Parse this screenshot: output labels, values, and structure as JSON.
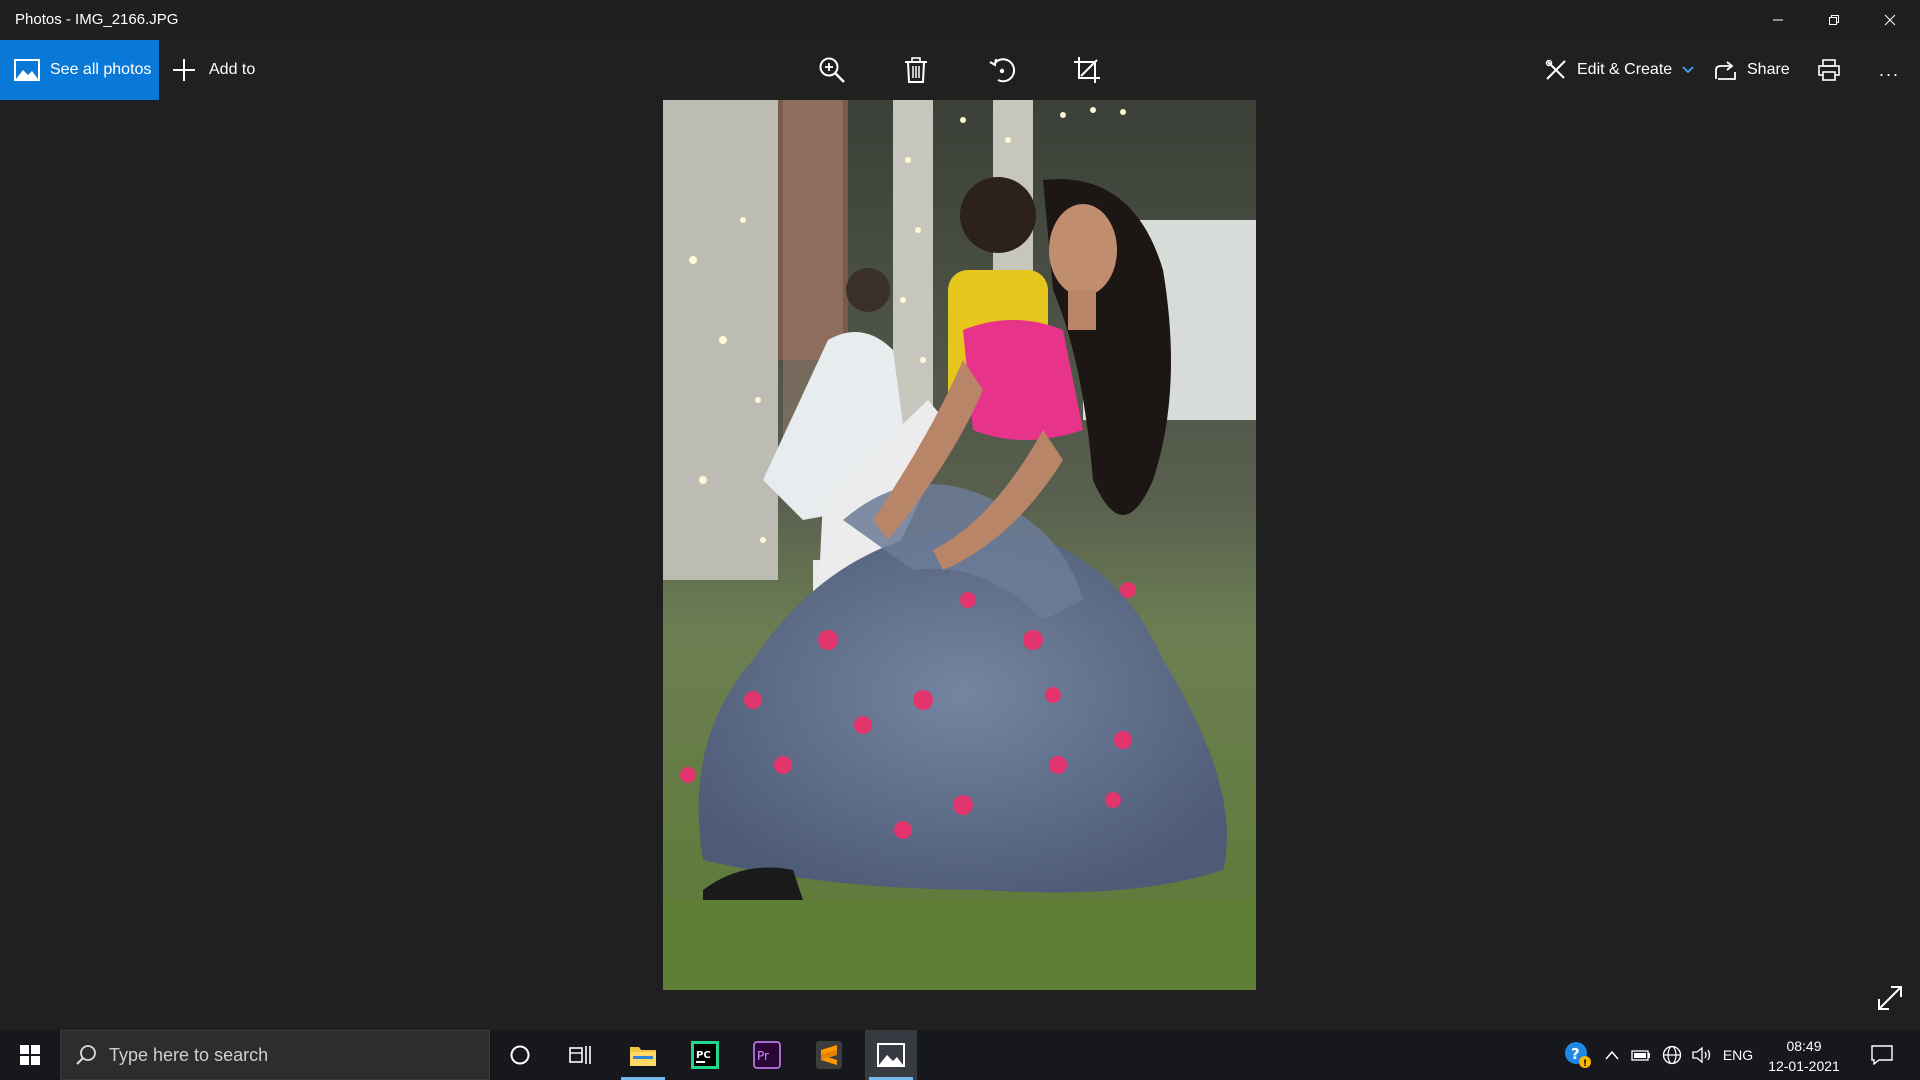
{
  "window": {
    "title": "Photos - IMG_2166.JPG",
    "controls": [
      "minimize",
      "restore",
      "close"
    ]
  },
  "toolbar": {
    "see_all_photos": "See all photos",
    "add_to": "Add to",
    "center_tools": [
      "zoom-in-icon",
      "delete-icon",
      "rotate-icon",
      "crop-icon"
    ],
    "edit_create": "Edit & Create",
    "share": "Share",
    "print": "print-icon",
    "more": "..."
  },
  "photo": {
    "description_colors": {
      "grass": "#5b7a34",
      "skirt": "#5d6d88",
      "blouse": "#e8338a",
      "background": "#3a3d38"
    }
  },
  "taskbar": {
    "search_placeholder": "Type here to search",
    "pinned": [
      "cortana-icon",
      "task-view-icon",
      "file-explorer-icon",
      "pycharm-icon",
      "premiere-pro-icon",
      "sublime-text-icon",
      "photos-icon"
    ],
    "tray": {
      "language": "ENG",
      "time": "08:49",
      "date": "12-01-2021"
    }
  },
  "colors": {
    "accent": "#0a78d7",
    "titlebar": "#1f1f1f",
    "canvas": "#202020",
    "taskbar": "#17181d"
  }
}
